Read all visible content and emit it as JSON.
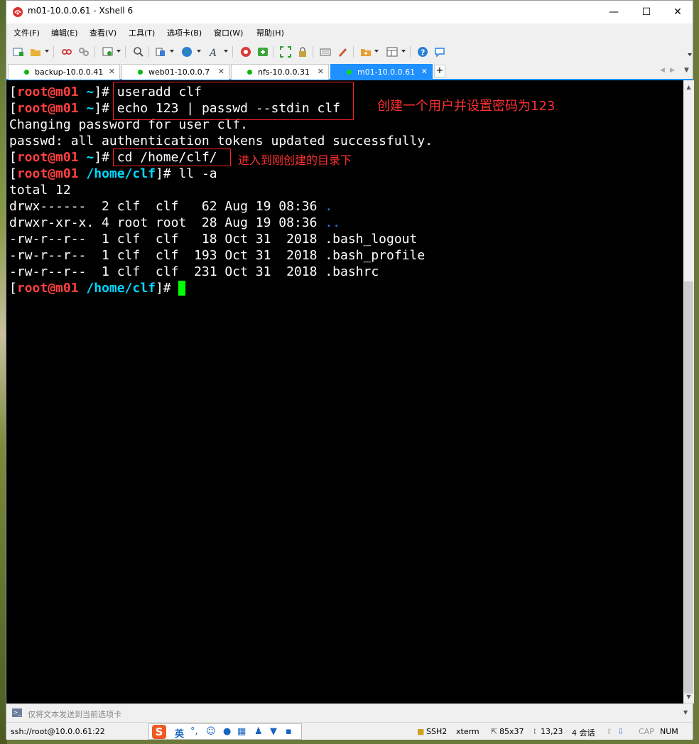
{
  "window": {
    "title": "m01-10.0.0.61 - Xshell 6",
    "minimize": "—",
    "maximize": "☐",
    "close": "✕"
  },
  "menu": [
    "文件(F)",
    "编辑(E)",
    "查看(V)",
    "工具(T)",
    "选项卡(B)",
    "窗口(W)",
    "帮助(H)"
  ],
  "tabs": [
    {
      "label": "backup-10.0.0.41",
      "active": false
    },
    {
      "label": "web01-10.0.0.7",
      "active": false
    },
    {
      "label": "nfs-10.0.0.31",
      "active": false
    },
    {
      "label": "m01-10.0.0.61",
      "active": true
    }
  ],
  "tab_close": "✕",
  "new_tab": "+",
  "terminal": {
    "prompt_user": "root@m01",
    "lines": {
      "l1_dir": "~",
      "l1_cmd": "useradd clf",
      "l2_dir": "~",
      "l2_cmd": "echo 123 | passwd --stdin clf",
      "l3": "Changing password for user clf.",
      "l4": "passwd: all authentication tokens updated successfully.",
      "l5_dir": "~",
      "l5_cmd": "cd /home/clf/",
      "l6_dir": "/home/clf",
      "l6_cmd": "ll -a",
      "l7": "total 12",
      "l8_meta": "drwx------  2 clf  clf   62 Aug 19 08:36 ",
      "l8_name": ".",
      "l9_meta": "drwxr-xr-x. 4 root root  28 Aug 19 08:36 ",
      "l9_name": "..",
      "l10": "-rw-r--r--  1 clf  clf   18 Oct 31  2018 .bash_logout",
      "l11": "-rw-r--r--  1 clf  clf  193 Oct 31  2018 .bash_profile",
      "l12": "-rw-r--r--  1 clf  clf  231 Oct 31  2018 .bashrc",
      "l13_dir": "/home/clf"
    },
    "annotation1": "创建一个用户并设置密码为123",
    "annotation2": "进入到刚创建的目录下"
  },
  "send_bar": {
    "placeholder": "仅将文本发送到当前选项卡"
  },
  "status": {
    "connection": "ssh://root@10.0.0.61:22",
    "protocol": "SSH2",
    "term_type": "xterm",
    "size": "85x37",
    "cursor_pos": "13,23",
    "sessions": "4 会话",
    "caps": "CAP",
    "num": "NUM"
  },
  "ime": {
    "logo": "S",
    "mode": "英"
  },
  "colors": {
    "prompt_user": "#ff4040",
    "prompt_dir": "#00d7ff",
    "cursor": "#00ff00",
    "annotation": "#ff3030",
    "active_tab": "#1e90ff"
  }
}
